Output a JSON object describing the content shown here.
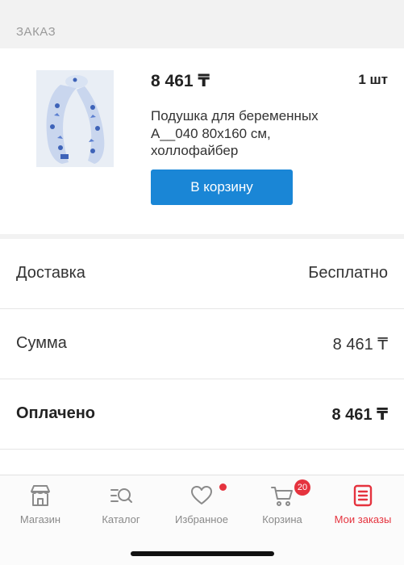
{
  "section": {
    "title": "ЗАКАЗ"
  },
  "order_item": {
    "price": "8 461 ₸",
    "quantity": "1 шт",
    "name_line1": "Подушка для беременных",
    "name_line2": "A__040 80x160 см,",
    "name_line3": "холлофайбер",
    "cart_button_label": "В корзину"
  },
  "summary": {
    "delivery_label": "Доставка",
    "delivery_value": "Бесплатно",
    "sum_label": "Сумма",
    "sum_value": "8 461 ₸",
    "paid_label": "Оплачено",
    "paid_value": "8 461 ₸"
  },
  "tabbar": {
    "shop_label": "Магазин",
    "catalog_label": "Каталог",
    "favorites_label": "Избранное",
    "cart_label": "Корзина",
    "cart_badge": "20",
    "orders_label": "Мои заказы"
  },
  "colors": {
    "accent": "#1a86d6",
    "active_tab": "#e5333e",
    "inactive_tab": "#8a8a8a"
  },
  "icons": [
    "store-icon",
    "catalog-search-icon",
    "heart-icon",
    "cart-icon",
    "orders-icon"
  ]
}
